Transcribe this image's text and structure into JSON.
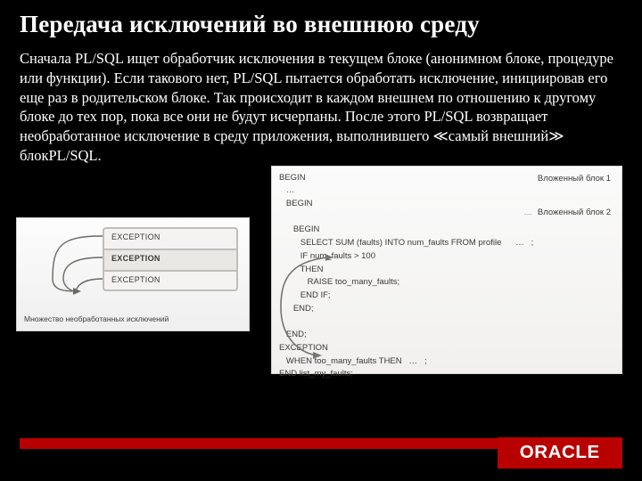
{
  "title": "Передача исключений во внешнюю среду",
  "paragraph": "Сначала PL/SQL ищет обработчик исключения в текущем блоке (анонимном блоке, процедуре или функции). Если такового нет, PL/SQL пытается обработать исключение, инициировав его еще раз в родительском блоке. Так происходит в каждом внешнем по отношению к другому блоке до тех пор, пока все они не будут исчерпаны. После этого PL/SQL возвращает необработанное исключение в среду приложения, выполнившего ≪самый внешний≫ блокPL/SQL.",
  "fig_left": {
    "rows": [
      "EXCEPTION",
      "EXCEPTION",
      "EXCEPTION"
    ],
    "caption": "Множество необработанных исключений"
  },
  "fig_right": {
    "label1": "Вложенный блок 1",
    "label2": "Вложенный блок 2",
    "code_lines": [
      "BEGIN",
      "   …",
      "   BEGIN",
      "",
      "      BEGIN",
      "         SELECT SUM (faults) INTO num_faults FROM profile      …   ;",
      "         IF num_faults > 100",
      "         THEN",
      "            RAISE too_many_faults;",
      "         END IF;",
      "      END;",
      "",
      "   END;",
      "EXCEPTION",
      "   WHEN too_many_faults THEN   …   ;",
      "END list_my_faults;"
    ]
  },
  "logo": "ORACLE"
}
